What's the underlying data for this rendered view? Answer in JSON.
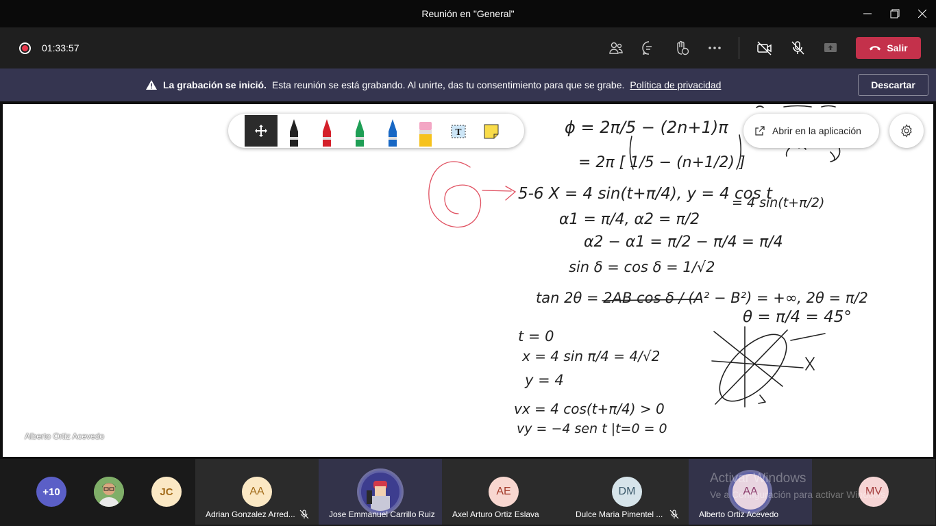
{
  "window": {
    "title": "Reunión en \"General\""
  },
  "toolbar": {
    "timer": "01:33:57",
    "leave_label": "Salir"
  },
  "banner": {
    "bold": "La grabación se inició.",
    "text": "Esta reunión se está grabando. Al unirte, das tu consentimiento para que se grabe.",
    "link": "Política de privacidad",
    "dismiss": "Descartar"
  },
  "whiteboard": {
    "open_app": "Abrir en la aplicación",
    "presenter": "Alberto Ortiz Acevedo",
    "notes": [
      "ϕ = 2π/5 − (2n+1)π",
      "= 2π [ 1/5 − (n+1/2) ]",
      "5-6  X = 4 sin(t+π/4), y = 4 cos t",
      "= 4 sin(t+π/2)",
      "α1 = π/4,  α2 = π/2",
      "α2 − α1 = π/2 − π/4 = π/4",
      "sin δ = cos δ = 1/√2",
      "tan 2θ = 2AB cos δ / (A² − B²) = +∞, 2θ = π/2",
      "θ = π/4 = 45°",
      "t = 0",
      "x = 4 sin π/4 = 4/√2",
      "y = 4",
      "vx = 4 cos(t+π/4) > 0",
      "vy = −4 sen t |t=0 = 0",
      "6"
    ]
  },
  "participants": {
    "overflow": "+10",
    "jc": "JC",
    "tiles": [
      {
        "initials": "AA",
        "name": "Adrian Gonzalez Arred...",
        "muted": true
      },
      {
        "initials": "",
        "name": "Jose Emmanuel Carrillo Ruiz",
        "muted": false
      },
      {
        "initials": "AE",
        "name": "Axel Arturo Ortiz Eslava",
        "muted": false
      },
      {
        "initials": "DM",
        "name": "Dulce Maria Pimentel ...",
        "muted": true
      },
      {
        "initials": "AA",
        "name": "Alberto Ortiz Acevedo",
        "muted": false
      },
      {
        "initials": "MV",
        "name": "",
        "muted": false
      }
    ]
  },
  "watermark": {
    "line1": "Activar Windows",
    "line2": "Ve a Configuración para activar Windows."
  },
  "colors": {
    "accent": "#6264a7",
    "leave": "#c4314b",
    "banner": "#353550",
    "ink": "#222222",
    "red_ink": "#e05060"
  }
}
